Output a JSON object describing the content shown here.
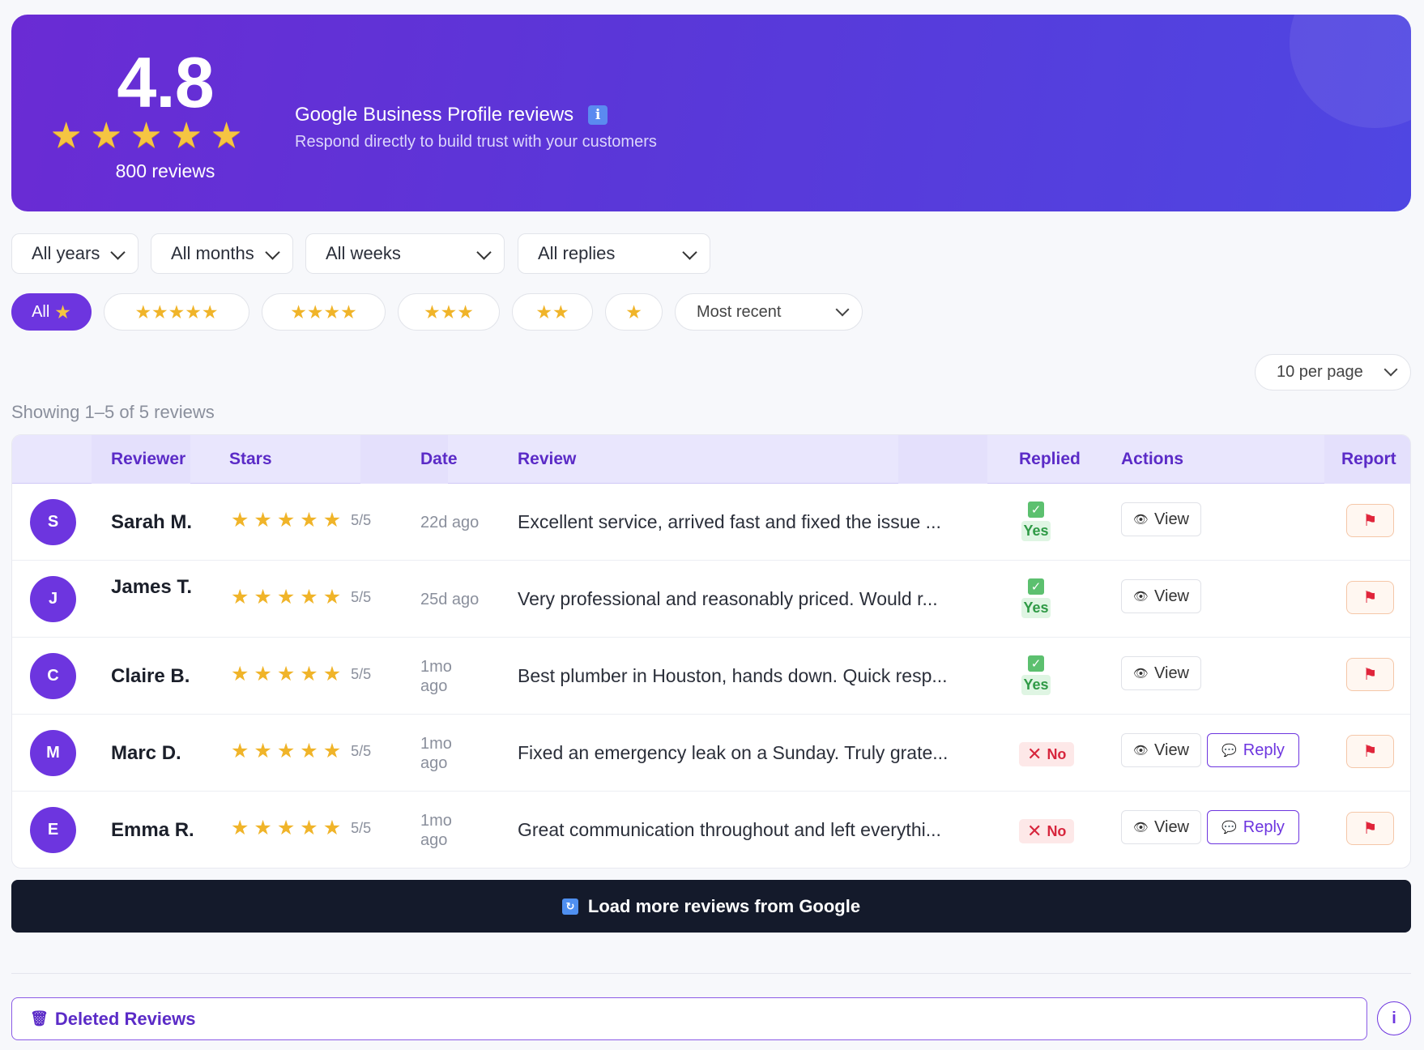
{
  "summary": {
    "score": "4.8",
    "stars": [
      "★",
      "★",
      "★",
      "★",
      "★"
    ],
    "reviews_count": "800 reviews",
    "title": "Google Business Profile reviews",
    "info_glyph": "i",
    "subtitle": "Respond directly to build trust with your customers"
  },
  "filters": {
    "years": "All years",
    "months": "All months",
    "weeks": "All weeks",
    "replies": "All replies"
  },
  "star_pills": {
    "all_label": "All",
    "sort": "Most recent"
  },
  "per_page": "10 per page",
  "showing": "Showing 1–5 of 5 reviews",
  "table": {
    "headers": {
      "reviewer": "Reviewer",
      "stars": "Stars",
      "date": "Date",
      "review": "Review",
      "replied": "Replied",
      "actions": "Actions",
      "report": "Report"
    },
    "rows": [
      {
        "initial": "S",
        "name": "Sarah M.",
        "rating": "5/5",
        "date": "22d ago",
        "review": "Excellent service, arrived fast and fixed the issue ...",
        "replied": "Yes",
        "view": "View"
      },
      {
        "initial": "J",
        "name": "James T.",
        "rating": "5/5",
        "date": "25d ago",
        "review": "Very professional and reasonably priced. Would r...",
        "replied": "Yes",
        "view": "View"
      },
      {
        "initial": "C",
        "name": "Claire B.",
        "rating": "5/5",
        "date": "1mo ago",
        "review": "Best plumber in Houston, hands down. Quick resp...",
        "replied": "Yes",
        "view": "View"
      },
      {
        "initial": "M",
        "name": "Marc D.",
        "rating": "5/5",
        "date": "1mo ago",
        "review": "Fixed an emergency leak on a Sunday. Truly grate...",
        "replied": "No",
        "view": "View",
        "reply": "Reply"
      },
      {
        "initial": "E",
        "name": "Emma R.",
        "rating": "5/5",
        "date": "1mo ago",
        "review": "Great communication throughout and left everythi...",
        "replied": "No",
        "view": "View",
        "reply": "Reply"
      }
    ]
  },
  "load_more": "Load more reviews from Google",
  "deleted": "Deleted Reviews",
  "colors": {
    "accent": "#6d35df",
    "hero_start": "#6a2bd4",
    "hero_end": "#4f46e2",
    "star": "#f0b429"
  }
}
